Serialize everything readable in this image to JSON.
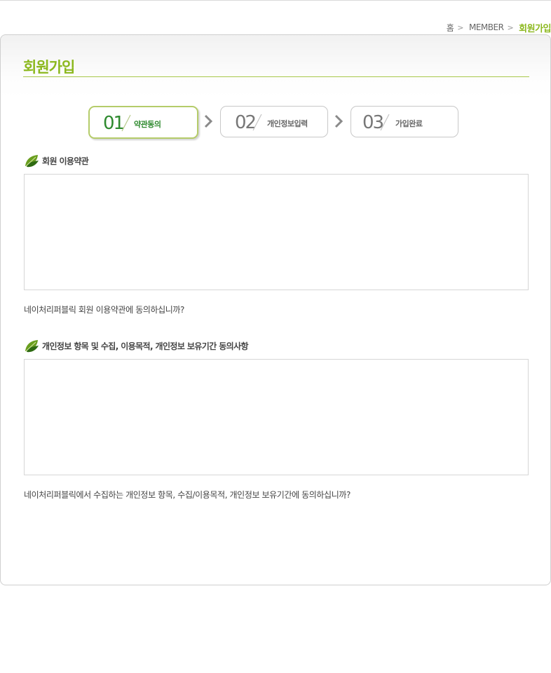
{
  "breadcrumb": {
    "home": "홈",
    "section": "MEMBER",
    "current": "회원가입"
  },
  "page": {
    "title": "회원가입"
  },
  "steps": [
    {
      "number": "01",
      "label": "약관동의",
      "active": true
    },
    {
      "number": "02",
      "label": "개인정보입력",
      "active": false
    },
    {
      "number": "03",
      "label": "가입완료",
      "active": false
    }
  ],
  "terms_section": {
    "heading": "회원 이용약관",
    "content": "",
    "question": "네이처리퍼블릭 회원 이용약관에 동의하십니까?"
  },
  "privacy_section": {
    "heading": "개인정보 항목 및 수집,  이용목적, 개인정보 보유기간 동의사항",
    "content": "",
    "question": "네이처리퍼블릭에서 수집하는 개인정보 항목, 수집/이용목적, 개인정보 보유기간에 동의하십니까?"
  },
  "colors": {
    "brand_green": "#8cb81e",
    "step_active": "#2f8a2f",
    "border": "#d6d6d6"
  },
  "icons": [
    "chevron-right-icon",
    "leaf-icon"
  ]
}
